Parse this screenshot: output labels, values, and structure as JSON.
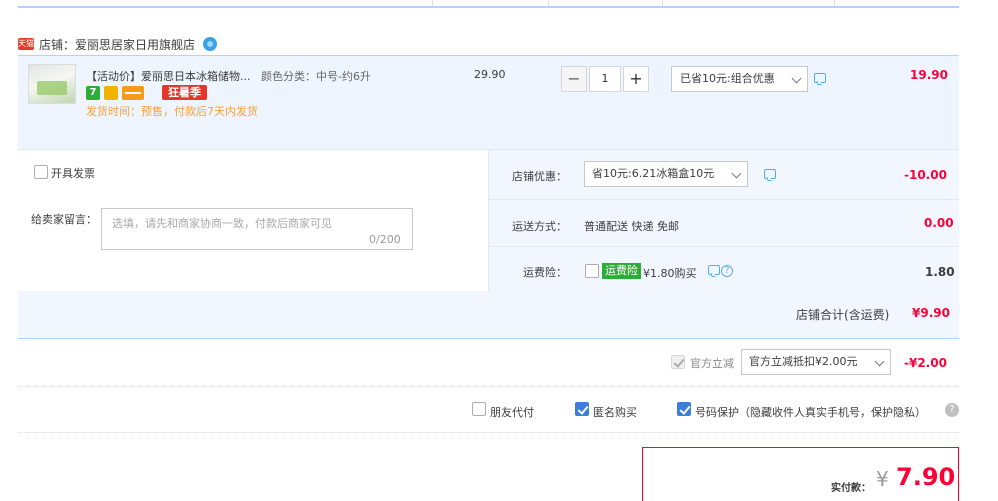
{
  "shop": {
    "badge": "天猫",
    "label": "店铺：爱丽思居家日用旗舰店"
  },
  "item": {
    "title": "【活动价】爱丽思日本冰箱储物...",
    "sku": "颜色分类：中号-约6升",
    "badge_7": "7",
    "badge_promo": "狂暑季",
    "ship_time": "发货时间：预售，付款后7天内发货",
    "price": "29.90",
    "quantity": "1",
    "qty_minus": "−",
    "qty_plus": "+",
    "discount_selected": "已省10元:组合优惠",
    "total": "19.90"
  },
  "options": {
    "invoice_label": "开具发票",
    "memo_label": "给卖家留言：",
    "memo_placeholder": "选填，请先和商家协商一致，付款后商家可见",
    "memo_count": "0/200",
    "shop_discount_label": "店铺优惠：",
    "shop_discount_selected": "省10元:6.21冰箱盒10元",
    "shop_discount_amount": "-10.00",
    "shipping_label": "运送方式：",
    "shipping_value": "普通配送 快递 免邮",
    "shipping_amount": "0.00",
    "insurance_label": "运费险：",
    "insurance_tag": "运费险",
    "insurance_price": "¥1.80购买",
    "insurance_amount": "1.80",
    "help_glyph": "?"
  },
  "subtotal": {
    "label": "店铺合计(含运费)",
    "amount": "¥9.90"
  },
  "official": {
    "label": "官方立减",
    "selected": "官方立减抵扣¥2.00元",
    "amount": "-¥2.00"
  },
  "extras": {
    "friend_pay": "朋友代付",
    "anonymous": "匿名购买",
    "number_protect": "号码保护（隐藏收件人真实手机号，保护隐私）",
    "help_glyph": "?"
  },
  "payment": {
    "label": "实付款：",
    "currency": "¥",
    "amount": "7.90"
  },
  "colors": {
    "accent_red": "#ff0036",
    "link_blue": "#3b7fdb",
    "panel_blue": "#eef5ff",
    "line_blue": "#b2d1ff"
  },
  "icons": [
    "tmall-icon",
    "wangwang-icon",
    "chat-icon",
    "help-icon",
    "chevron-down-icon"
  ]
}
